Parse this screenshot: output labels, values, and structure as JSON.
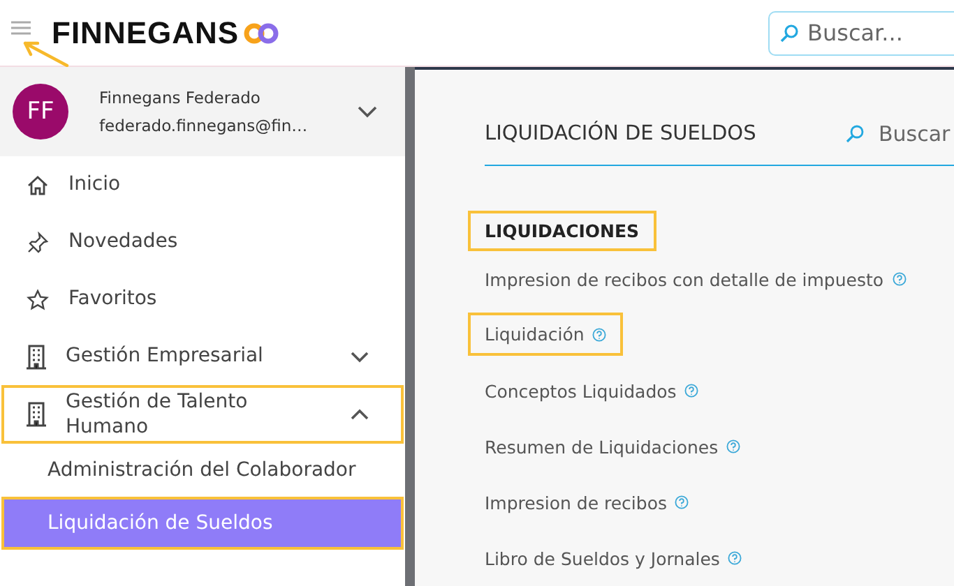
{
  "header": {
    "logo": "FINNEGANS",
    "search": {
      "placeholder": "Buscar..."
    }
  },
  "user": {
    "initials": "FF",
    "name": "Finnegans Federado",
    "email": "federado.finnegans@fin…",
    "expanded": false
  },
  "sidebar": {
    "items": [
      {
        "label": "Inicio",
        "kind": "home",
        "highlighted": false
      },
      {
        "label": "Novedades",
        "kind": "pin",
        "highlighted": false
      },
      {
        "label": "Favoritos",
        "kind": "star",
        "highlighted": false
      },
      {
        "label": "Gestión Empresarial",
        "kind": "building",
        "expanded": false,
        "highlighted": false
      },
      {
        "label": "Gestión de Talento Humano",
        "kind": "building",
        "expanded": true,
        "highlighted": true,
        "children": [
          {
            "label": "Administración del Colaborador",
            "selected": false,
            "highlighted": false
          },
          {
            "label": "Liquidación de Sueldos",
            "selected": true,
            "highlighted": true
          }
        ]
      }
    ]
  },
  "main": {
    "title": "LIQUIDACIÓN DE SUELDOS",
    "search": {
      "placeholder": "Buscar"
    },
    "section": {
      "heading": "LIQUIDACIONES",
      "highlighted": true
    },
    "links": [
      {
        "label": "Impresion de recibos con detalle de impuesto",
        "highlighted": false
      },
      {
        "label": "Liquidación",
        "highlighted": true
      },
      {
        "label": "Conceptos Liquidados",
        "highlighted": false
      },
      {
        "label": "Resumen de Liquidaciones",
        "highlighted": false
      },
      {
        "label": "Impresion de recibos",
        "highlighted": false
      },
      {
        "label": "Libro de Sueldos y Jornales",
        "highlighted": false
      }
    ]
  }
}
